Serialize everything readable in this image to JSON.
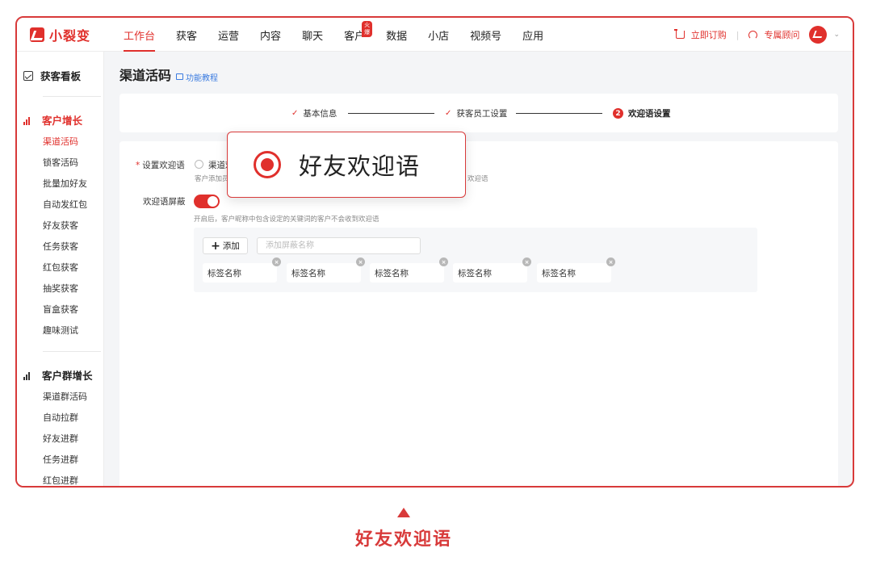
{
  "brand": {
    "name": "小裂变",
    "color": "#e0302c"
  },
  "nav": {
    "items": [
      {
        "label": "工作台",
        "active": true
      },
      {
        "label": "获客"
      },
      {
        "label": "运营"
      },
      {
        "label": "内容"
      },
      {
        "label": "聊天"
      },
      {
        "label": "客户",
        "badge": "火爆"
      },
      {
        "label": "数据"
      },
      {
        "label": "小店"
      },
      {
        "label": "视频号"
      },
      {
        "label": "应用"
      }
    ],
    "order_label": "立即订购",
    "consultant_label": "专属顾问"
  },
  "sidebar": {
    "dashboard": "获客看板",
    "group1": {
      "title": "客户增长",
      "items": [
        "渠道活码",
        "锁客活码",
        "批量加好友",
        "自动发红包",
        "好友获客",
        "任务获客",
        "红包获客",
        "抽奖获客",
        "盲盒获客",
        "趣味测试"
      ],
      "active_index": 0
    },
    "group2": {
      "title": "客户群增长",
      "items": [
        "渠道群活码",
        "自动拉群",
        "好友进群",
        "任务进群",
        "红包进群"
      ]
    }
  },
  "page": {
    "title": "渠道活码",
    "tutorial": "功能教程"
  },
  "steps": [
    {
      "label": "基本信息",
      "state": "done"
    },
    {
      "label": "获客员工设置",
      "state": "done"
    },
    {
      "label": "欢迎语设置",
      "state": "current",
      "number": "2"
    }
  ],
  "form": {
    "welcome_label": "设置欢迎语",
    "radio_option": "渠道欢",
    "radio_hint_left": "客户添加员",
    "radio_hint_right": "欢迎语",
    "block_label": "欢迎语屏蔽",
    "block_enabled": true,
    "block_hint": "开启后，客户昵称中包含设定的关键词的客户不会收到欢迎语",
    "add_button": "添加",
    "tag_input_placeholder": "添加屏蔽名称",
    "tags": [
      "标签名称",
      "标签名称",
      "标签名称",
      "标签名称",
      "标签名称"
    ]
  },
  "callout": {
    "text": "好友欢迎语"
  },
  "caption": "好友欢迎语"
}
